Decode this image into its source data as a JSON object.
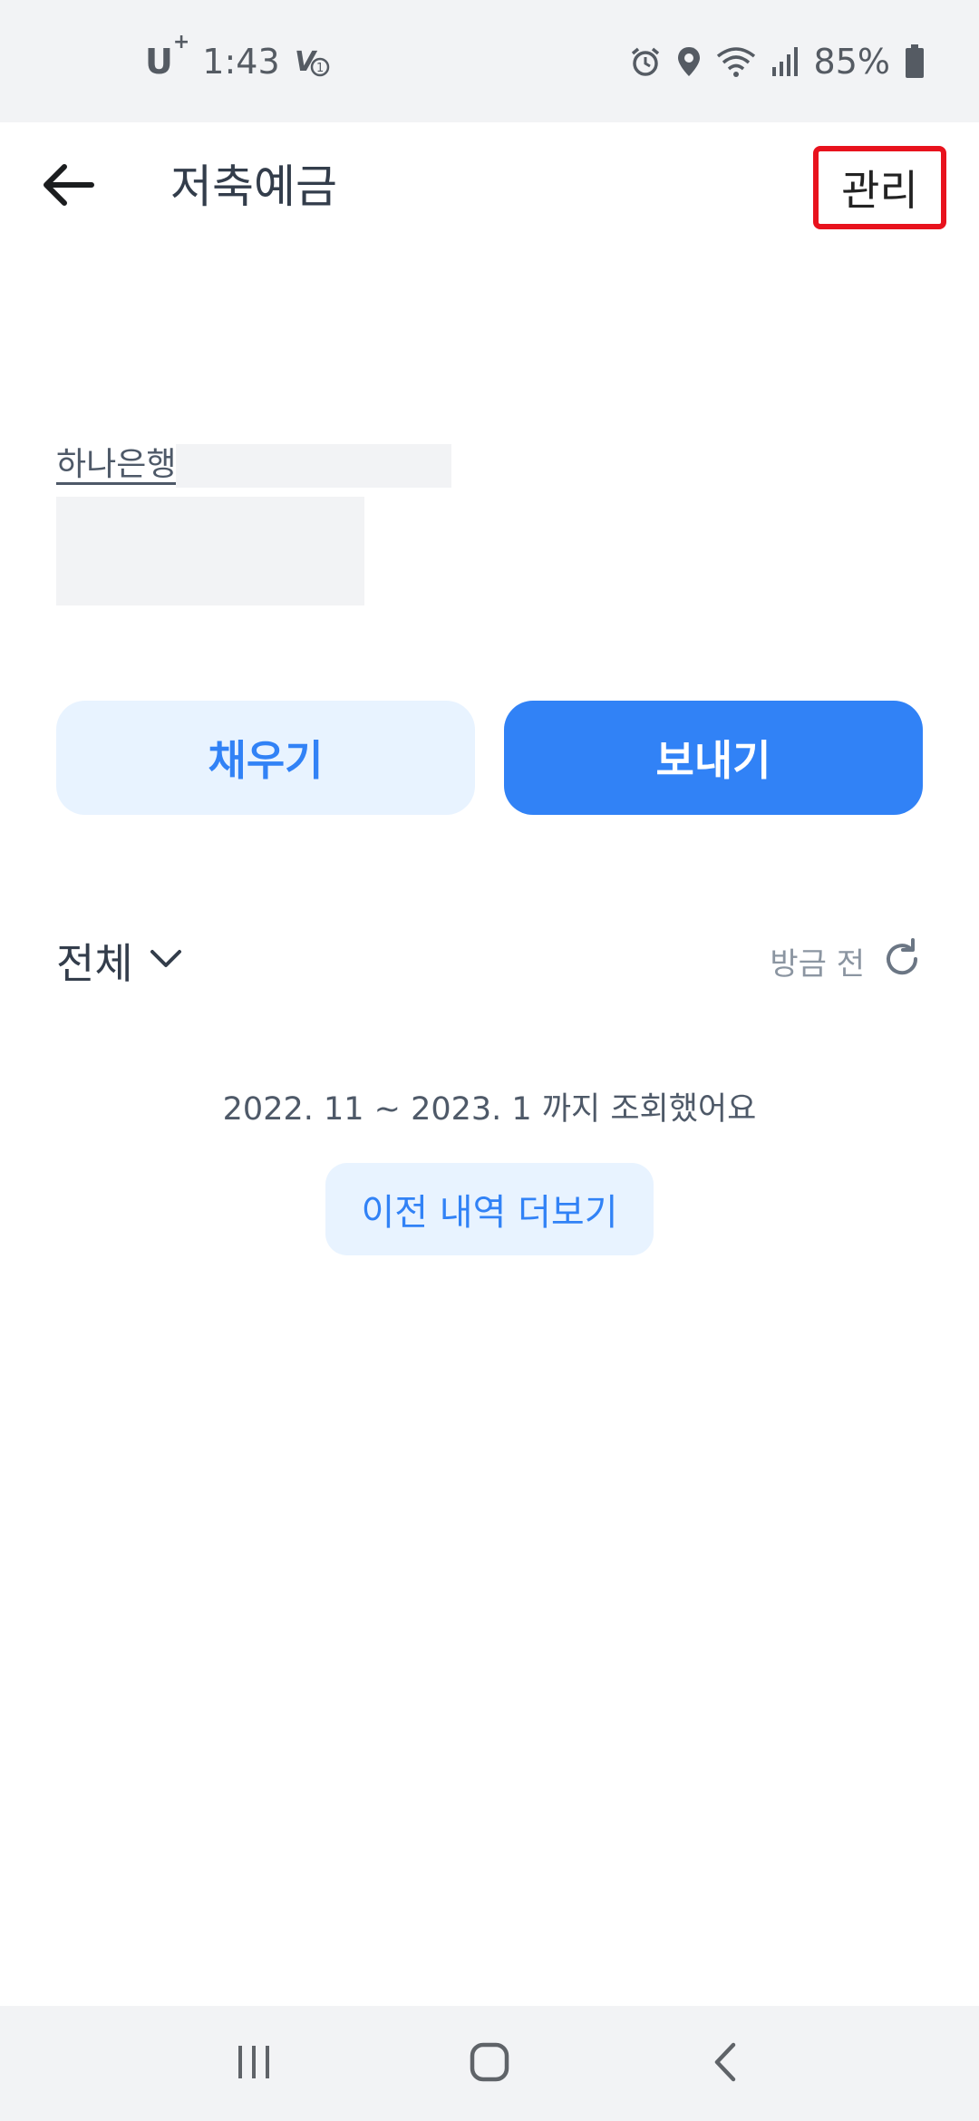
{
  "status_bar": {
    "carrier": "U",
    "carrier_sup": "+",
    "time": "1:43",
    "battery": "85%"
  },
  "header": {
    "back_icon": "arrow-left-icon",
    "title": "저축예금",
    "manage_label": "관리"
  },
  "account": {
    "bank_name": "하나은행"
  },
  "actions": {
    "fill_label": "채우기",
    "send_label": "보내기"
  },
  "filter": {
    "selected": "전체",
    "refresh_label": "방금 전"
  },
  "history": {
    "range_text": "2022. 11 ~ 2023. 1 까지 조회했어요",
    "more_label": "이전 내역 더보기"
  },
  "colors": {
    "accent": "#3182f6",
    "accent_light": "#e8f3ff",
    "highlight_border": "#e8121d"
  }
}
